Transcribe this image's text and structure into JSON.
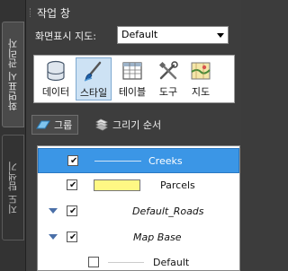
{
  "window": {
    "title": "작업 창"
  },
  "side_tabs": [
    {
      "label": "화면표시 관리자",
      "active": true
    },
    {
      "label": "지도 탐색기",
      "active": false
    }
  ],
  "map_selector": {
    "label": "화면표시 지도:",
    "value": "Default"
  },
  "toolbar": {
    "buttons": [
      {
        "label": "데이터",
        "icon": "database-icon"
      },
      {
        "label": "스타일",
        "icon": "paintbrush-icon",
        "active": true
      },
      {
        "label": "테이블",
        "icon": "table-icon"
      },
      {
        "label": "도구",
        "icon": "tools-icon"
      },
      {
        "label": "지도",
        "icon": "map-icon"
      }
    ]
  },
  "view_tabs": [
    {
      "label": "그룹",
      "icon": "group-icon",
      "active": true
    },
    {
      "label": "그리기 순서",
      "icon": "draw-order-icon",
      "active": false
    }
  ],
  "layers": [
    {
      "name": "Creeks",
      "checked": true,
      "selected": true,
      "style": "line",
      "italic": false
    },
    {
      "name": "Parcels",
      "checked": true,
      "selected": false,
      "style": "box",
      "italic": false
    },
    {
      "name": "Default_Roads",
      "checked": true,
      "selected": false,
      "expandable": true,
      "italic": true
    },
    {
      "name": "Map Base",
      "checked": true,
      "selected": false,
      "expandable": true,
      "italic": true
    },
    {
      "name": "Default",
      "checked": false,
      "selected": false,
      "style": "line",
      "italic": false
    }
  ],
  "colors": {
    "panel_bg": "#3d3d3d",
    "selection": "#3b96e6",
    "parcel_fill": "#fff884",
    "creek_line": "#6f9fd4"
  }
}
